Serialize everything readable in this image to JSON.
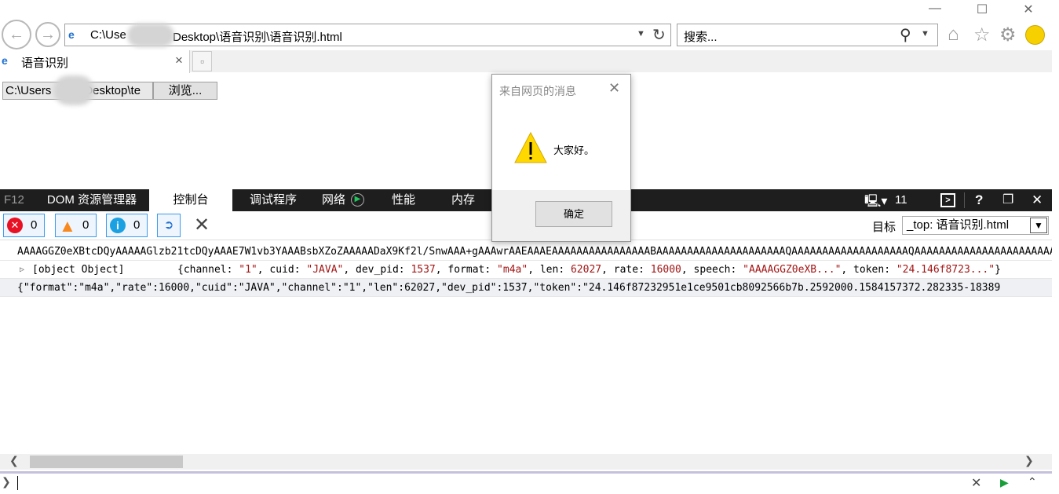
{
  "browser": {
    "address": "C:\\Use",
    "address_suffix": "Desktop\\语音识别\\语音识别.html",
    "search_placeholder": "搜索...",
    "tab_title": "语音识别",
    "tab_close": "×"
  },
  "page": {
    "file_path_prefix": "C:\\Users",
    "file_path_suffix": "Desktop\\te",
    "browse_label": "浏览..."
  },
  "dialog": {
    "title": "来自网页的消息",
    "message": "大家好。",
    "ok_label": "确定"
  },
  "devtools": {
    "f12": "F12",
    "tabs": [
      {
        "label": "DOM 资源管理器"
      },
      {
        "label": "控制台"
      },
      {
        "label": "调试程序"
      },
      {
        "label": "网络"
      },
      {
        "label": "性能"
      },
      {
        "label": "内存"
      }
    ],
    "active_tab": "控制台",
    "doc_mode": "11",
    "errors": "0",
    "warnings": "0",
    "infos": "0",
    "target_label": "目标",
    "target_value": "_top: 语音识别.html"
  },
  "console": {
    "line1": "AAAAGGZ0eXBtcDQyAAAAAGlzb21tcDQyAAAE7W1vb3YAAABsbXZoZAAAAADaX9Kf2l/SnwAAA+gAAAwrAAEAAAEAAAAAAAAAAAAAAAABAAAAAAAAAAAAAAAAAAAAAQAAAAAAAAAAAAAAAAAAAQAAAAAAAAAAAAAAAAAAAAAAAAAAAAAA",
    "line2_label": "[object Object]",
    "line2": [
      {
        "t": "{channel: "
      },
      {
        "t": "\"1\"",
        "c": "red"
      },
      {
        "t": ", cuid: "
      },
      {
        "t": "\"JAVA\"",
        "c": "red"
      },
      {
        "t": ", dev_pid: "
      },
      {
        "t": "1537",
        "c": "red"
      },
      {
        "t": ", format: "
      },
      {
        "t": "\"m4a\"",
        "c": "red"
      },
      {
        "t": ", len: "
      },
      {
        "t": "62027",
        "c": "red"
      },
      {
        "t": ", rate: "
      },
      {
        "t": "16000",
        "c": "red"
      },
      {
        "t": ", speech: "
      },
      {
        "t": "\"AAAAGGZ0eXB...\"",
        "c": "red"
      },
      {
        "t": ", token: "
      },
      {
        "t": "\"24.146f8723...\"",
        "c": "red"
      },
      {
        "t": "}"
      }
    ],
    "line3": "{\"format\":\"m4a\",\"rate\":16000,\"cuid\":\"JAVA\",\"channel\":\"1\",\"len\":62027,\"dev_pid\":1537,\"token\":\"24.146f87232951e1ce9501cb8092566b7b.2592000.1584157372.282335-18389"
  },
  "colors": {
    "accent": "#3c9bf0",
    "devtools_bar": "#1e1e1e",
    "error": "#e81123",
    "warning": "#f7891e",
    "info": "#1ba1e2"
  }
}
